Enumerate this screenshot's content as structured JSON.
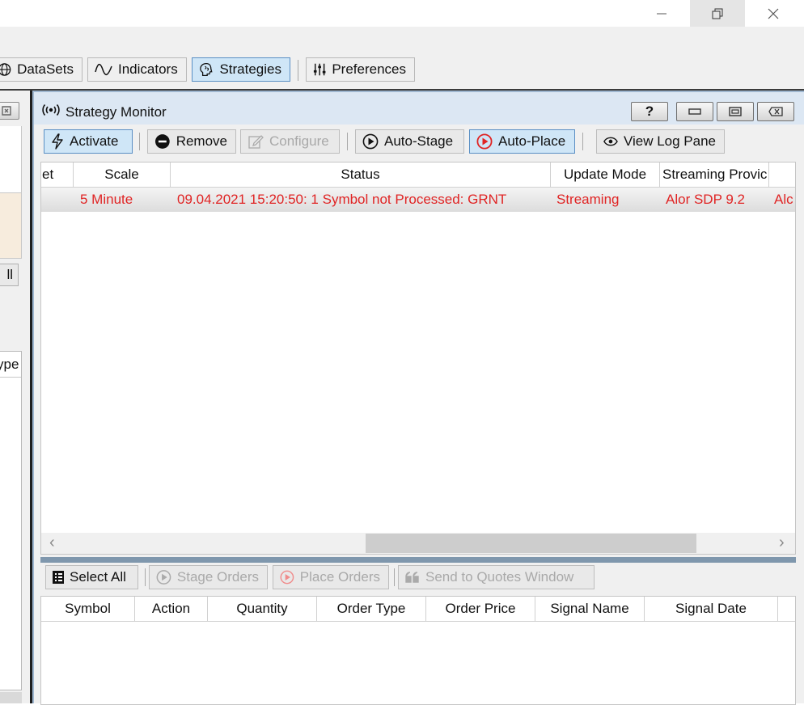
{
  "titlebar": {
    "minimize_icon": "minimize-icon",
    "restore_icon": "restore-icon",
    "close_icon": "close-icon"
  },
  "toolbar": {
    "items": [
      {
        "label": "DataSets",
        "icon": "globe-icon"
      },
      {
        "label": "Indicators",
        "icon": "wave-icon"
      },
      {
        "label": "Strategies",
        "icon": "brain-icon",
        "active": true
      },
      {
        "label": "Preferences",
        "icon": "sliders-icon"
      }
    ]
  },
  "left_panel": {
    "button_fragment": "ll",
    "field_fragment": "ype"
  },
  "monitor": {
    "title": "Strategy Monitor",
    "help_label": "?",
    "toolbar": {
      "activate": "Activate",
      "remove": "Remove",
      "configure": "Configure",
      "auto_stage": "Auto-Stage",
      "auto_place": "Auto-Place",
      "view_log": "View Log Pane"
    },
    "columns": [
      "et",
      "Scale",
      "Status",
      "Update Mode",
      "Streaming Provic"
    ],
    "row": {
      "scale": "5 Minute",
      "status": "09.04.2021 15:20:50: 1 Symbol not Processed: GRNT",
      "update_mode": "Streaming",
      "streaming_provider": "Alor SDP 9.2",
      "extra": "Alc"
    },
    "scroll_left": "‹",
    "scroll_right": "›"
  },
  "orders": {
    "toolbar": {
      "select_all": "Select All",
      "stage_orders": "Stage Orders",
      "place_orders": "Place Orders",
      "send_quotes": "Send to Quotes Window"
    },
    "columns": [
      "Symbol",
      "Action",
      "Quantity",
      "Order Type",
      "Order Price",
      "Signal Name",
      "Signal Date"
    ]
  },
  "colors": {
    "accent_active": "#cfe6f7",
    "error_text": "#e02424"
  }
}
